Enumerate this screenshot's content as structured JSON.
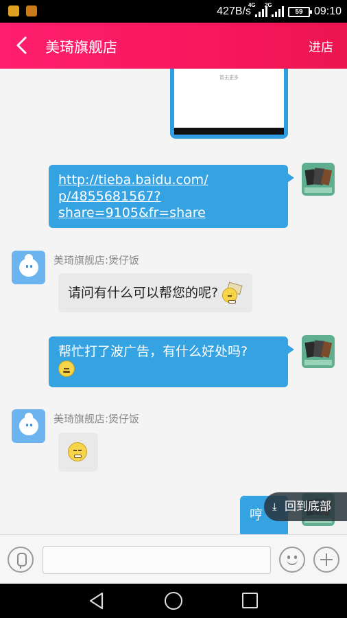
{
  "status_bar": {
    "speed": "427B/s",
    "net1": "4G",
    "net2": "2G",
    "battery": "59",
    "time": "09:10"
  },
  "header": {
    "title": "美琦旗舰店",
    "enter_label": "进店"
  },
  "screenshot_card": {
    "text": "暂无更多"
  },
  "messages": [
    {
      "side": "right",
      "lines": [
        "http://tieba.baidu.com/",
        "p/4855681567?",
        "share=9105&fr=share"
      ],
      "is_link": true
    },
    {
      "side": "left",
      "sender": "美琦旗舰店:煲仔饭",
      "text": "请问有什么可以帮您的呢?",
      "emoji": "tissue-smile"
    },
    {
      "side": "right",
      "text": "帮忙打了波广告，有什么好处吗?",
      "emoji": "sly-smile"
    },
    {
      "side": "left",
      "sender": "美琦旗舰店:煲仔饭",
      "text": "",
      "emoji": "laugh-sweat"
    },
    {
      "side": "right",
      "text": "哼"
    }
  ],
  "scroll_to_bottom": {
    "label": "回到底部"
  },
  "input": {
    "placeholder": ""
  }
}
